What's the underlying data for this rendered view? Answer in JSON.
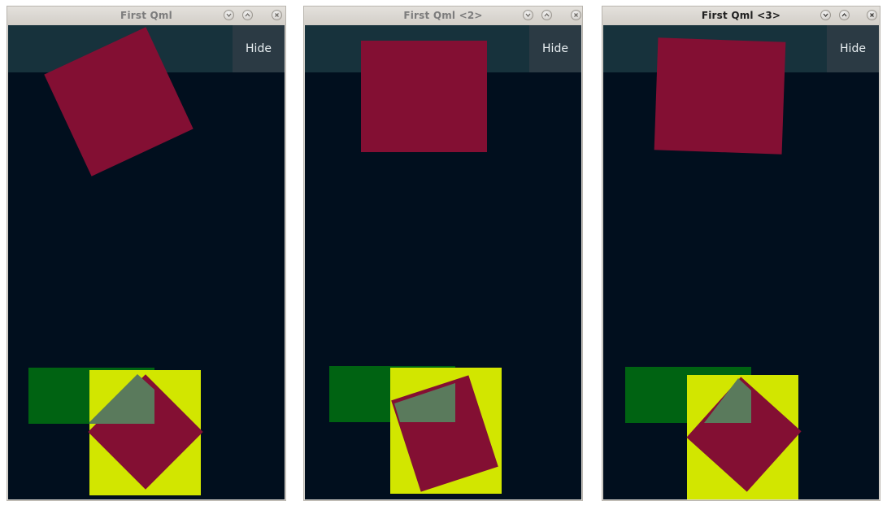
{
  "windows": [
    {
      "title": "First Qml",
      "active": false,
      "hide_label": "Hide"
    },
    {
      "title": "First Qml <2>",
      "active": false,
      "hide_label": "Hide"
    },
    {
      "title": "First Qml <3>",
      "active": true,
      "hide_label": "Hide"
    }
  ],
  "colors": {
    "background": "#010f1e",
    "header_bar": "#17323c",
    "hide_button": "#2b3a44",
    "crimson_square": "#830f33",
    "green_rect": "#006312",
    "yellow_square": "#d2e600",
    "overlap_tint": "#5a7a5c"
  },
  "icons": [
    "minimize-icon",
    "maximize-icon",
    "close-icon"
  ]
}
